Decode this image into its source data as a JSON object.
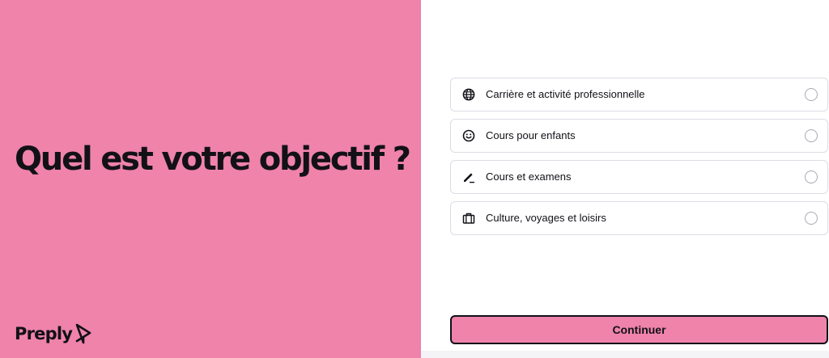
{
  "hero": {
    "title": "Quel est votre objectif ?",
    "background": "#ef83aa"
  },
  "brand": {
    "name": "Preply",
    "icon": "preply-logo-icon"
  },
  "options": [
    {
      "label": "Carrière et activité professionnelle",
      "icon": "globe-icon",
      "selected": false
    },
    {
      "label": "Cours pour enfants",
      "icon": "smiley-icon",
      "selected": false
    },
    {
      "label": "Cours et examens",
      "icon": "pencil-icon",
      "selected": false
    },
    {
      "label": "Culture, voyages et loisirs",
      "icon": "suitcase-icon",
      "selected": false
    }
  ],
  "actions": {
    "continue_label": "Continuer",
    "accent": "#ef83aa"
  }
}
